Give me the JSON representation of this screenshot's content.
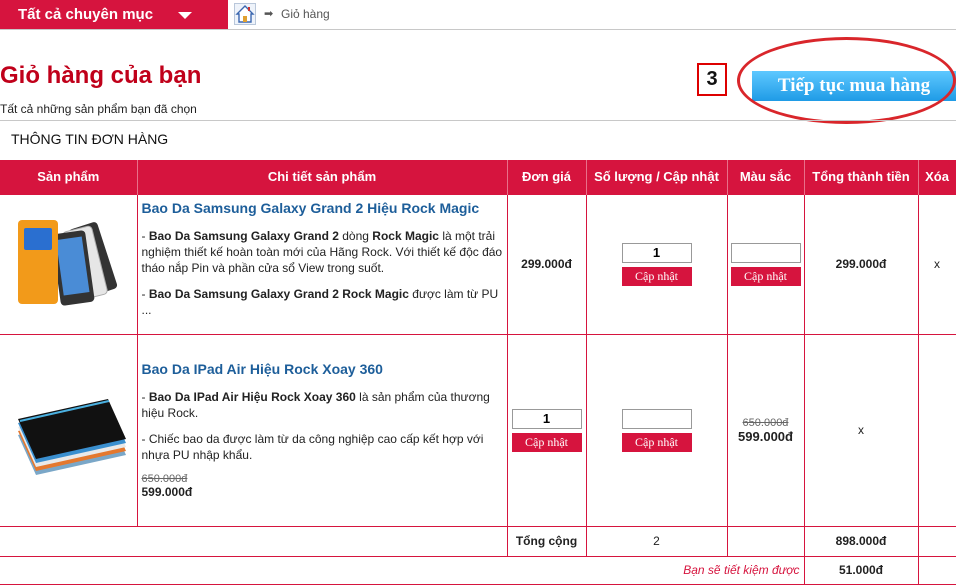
{
  "header": {
    "category_menu": "Tất cả chuyên mục",
    "breadcrumb_arrow": "➡",
    "breadcrumb_current": "Giỏ hàng"
  },
  "page": {
    "title": "Giỏ hàng của bạn",
    "subtitle": "Tất cả những sản phẩm bạn đã chọn",
    "step_number": "3",
    "continue_button": "Tiếp tục mua hàng",
    "section_title": "THÔNG TIN ĐƠN HÀNG"
  },
  "table": {
    "headers": [
      "Sản phẩm",
      "Chi tiết sản phẩm",
      "Đơn giá",
      "Số lượng / Cập nhật",
      "Màu sắc",
      "Tổng thành tiền",
      "Xóa"
    ],
    "update_label": "Cập nhật",
    "delete_label": "x",
    "rows": [
      {
        "name": "Bao Da Samsung Galaxy Grand 2 Hiệu Rock Magic",
        "desc1_pre": "- ",
        "desc1_b1": "Bao Da Samsung Galaxy Grand 2",
        "desc1_mid": " dòng ",
        "desc1_b2": "Rock Magic",
        "desc1_post": " là một trải nghiệm thiết kế hoàn toàn mới của Hãng Rock. Với thiết kế độc đáo tháo nắp Pin và phần cửa sổ View trong suốt.",
        "desc2_pre": "- ",
        "desc2_b1": "Bao Da Samsung Galaxy Grand 2 Rock Magic",
        "desc2_post": " được làm từ PU ...",
        "unit_price": "299.000đ",
        "quantity": "1",
        "total": "299.000đ"
      },
      {
        "name": "Bao Da IPad Air Hiệu Rock Xoay 360",
        "desc1_pre": "- ",
        "desc1_b1": "Bao Da IPad Air Hiệu Rock Xoay 360",
        "desc1_post": " là sản phẩm của thương hiệu Rock.",
        "desc2": "- Chiếc bao da được làm từ da công nghiệp cao cấp kết hợp với nhựa PU nhập khẩu.",
        "old_price": "650.000đ",
        "new_price": "599.000đ",
        "quantity": "1",
        "unit_old_price": "650.000đ",
        "unit_new_price": "599.000đ",
        "delete_label": "x"
      }
    ],
    "sum_label": "Tổng cộng",
    "sum_quantity": "2",
    "sum_total": "898.000đ",
    "saving_label": "Bạn sẽ tiết kiệm được",
    "saving_value": "51.000đ"
  },
  "colors": {
    "accent": "#d6143e",
    "title": "#c0001a",
    "link": "#1d5e9a",
    "continue_button": "#2aa8f0"
  }
}
